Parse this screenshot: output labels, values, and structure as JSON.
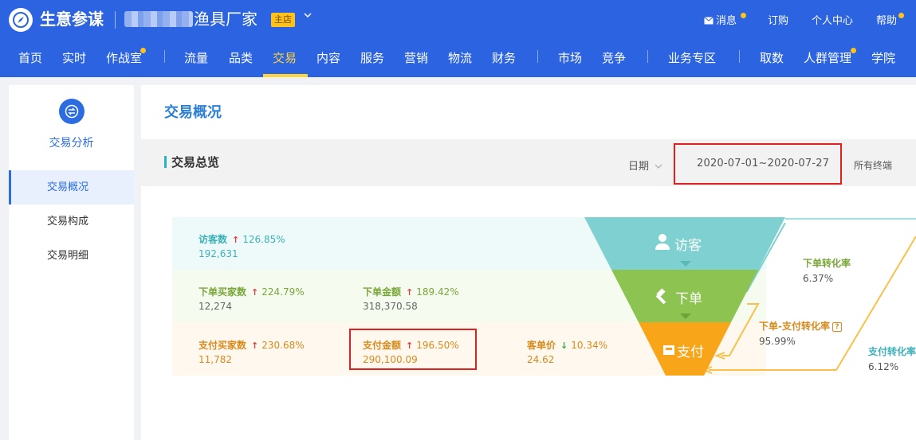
{
  "header": {
    "brand": "生意参谋",
    "shop_name": "渔具厂家",
    "shop_tag": "主店",
    "top_links": {
      "message": "消息",
      "subscribe": "订购",
      "profile": "个人中心",
      "help": "帮助"
    },
    "nav": {
      "home": "首页",
      "realtime": "实时",
      "warroom": "作战室",
      "traffic": "流量",
      "category": "品类",
      "trade": "交易",
      "content": "内容",
      "service": "服务",
      "marketing": "营销",
      "logistics": "物流",
      "finance": "财务",
      "market": "市场",
      "competition": "竞争",
      "business_zone": "业务专区",
      "data_fetch": "取数",
      "crowd": "人群管理",
      "academy": "学院"
    }
  },
  "sidebar": {
    "title": "交易分析",
    "items": [
      {
        "label": "交易概况"
      },
      {
        "label": "交易构成"
      },
      {
        "label": "交易明细"
      }
    ]
  },
  "main": {
    "page_title": "交易概况",
    "section_title": "交易总览",
    "date_label": "日期",
    "date_range": "2020-07-01~2020-07-27",
    "terminal_label": "所有终端"
  },
  "funnel": {
    "stages": {
      "visitor": "访客",
      "order": "下单",
      "pay": "支付"
    },
    "metrics": {
      "visitors": {
        "label": "访客数",
        "change": "126.85%",
        "value": "192,631"
      },
      "order_buyers": {
        "label": "下单买家数",
        "change": "224.79%",
        "value": "12,274"
      },
      "order_amount": {
        "label": "下单金额",
        "change": "189.42%",
        "value": "318,370.58"
      },
      "pay_buyers": {
        "label": "支付买家数",
        "change": "230.68%",
        "value": "11,782"
      },
      "pay_amount": {
        "label": "支付金额",
        "change": "196.50%",
        "value": "290,100.09"
      },
      "unit_price": {
        "label": "客单价",
        "change": "10.34%",
        "value": "24.62"
      }
    },
    "conversions": {
      "order_rate": {
        "label": "下单转化率",
        "value": "6.37%"
      },
      "order_pay_rate": {
        "label": "下单-支付转化率",
        "value": "95.99%"
      },
      "pay_rate": {
        "label": "支付转化率",
        "value": "6.12%"
      }
    }
  },
  "colors": {
    "header_bg": "#2b63e0",
    "accent_yellow": "#ffd43b",
    "teal": "#7fd0d0",
    "green": "#8dc351",
    "orange": "#f9a51a",
    "highlight_red": "#e02020"
  }
}
